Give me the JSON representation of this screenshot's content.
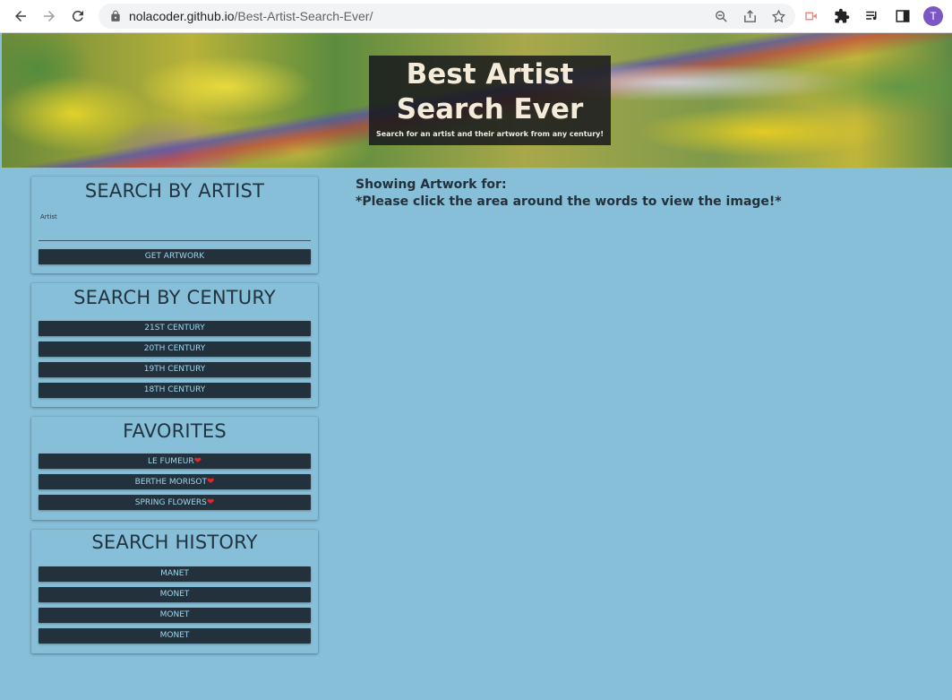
{
  "browser": {
    "url_host": "nolacoder.github.io",
    "url_path": "/Best-Artist-Search-Ever/",
    "profile_initial": "T"
  },
  "hero": {
    "title": "Best Artist Search Ever",
    "subtitle": "Search for an artist and their artwork from any century!"
  },
  "artist_search": {
    "title": "SEARCH BY ARTIST",
    "field_label": "Artist",
    "field_value": "",
    "button_label": "GET ARTWORK"
  },
  "century_search": {
    "title": "SEARCH BY CENTURY",
    "buttons": [
      "21ST CENTURY",
      "20TH CENTURY",
      "19TH CENTURY",
      "18TH CENTURY"
    ]
  },
  "favorites": {
    "title": "FAVORITES",
    "items": [
      "LE FUMEUR",
      "BERTHE MORISOT",
      "SPRING FLOWERS"
    ],
    "heart_glyph": "❤"
  },
  "history": {
    "title": "SEARCH HISTORY",
    "items": [
      "MANET",
      "MONET",
      "MONET",
      "MONET"
    ]
  },
  "main": {
    "showing_label": "Showing Artwork for:",
    "instruction": "*Please click the area around the words to view the image!*"
  },
  "colors": {
    "page_bg": "#87bfd8",
    "button_bg": "#22313c",
    "button_text": "#9fd6ee",
    "heading_text": "#233441",
    "heart": "#e32626"
  }
}
